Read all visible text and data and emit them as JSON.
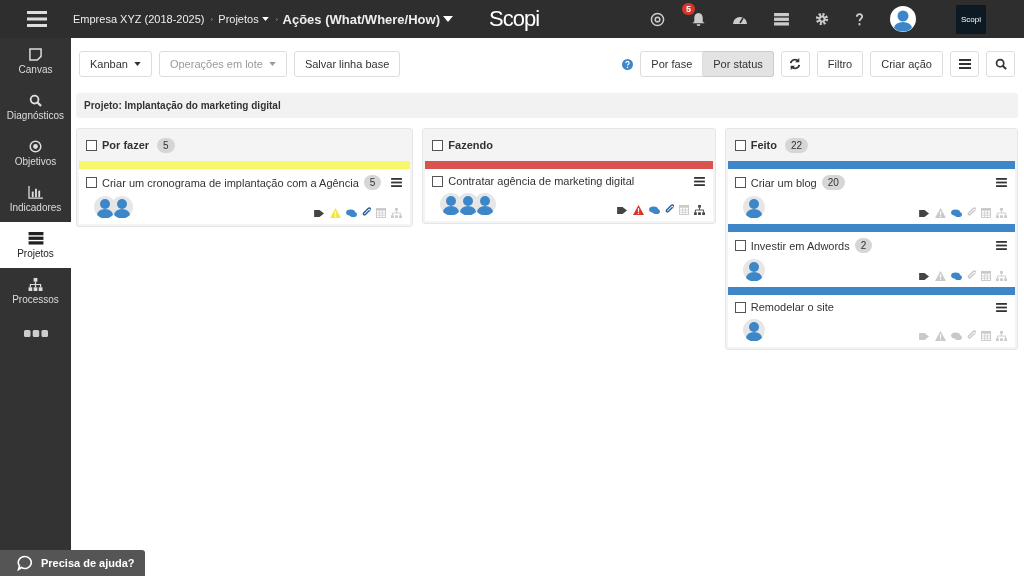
{
  "topbar": {
    "breadcrumb": [
      {
        "label": "Empresa XYZ (2018-2025)",
        "dropdown": false,
        "current": false
      },
      {
        "label": "Projetos",
        "dropdown": true,
        "current": false
      },
      {
        "label": "Ações (What/Where/How)",
        "dropdown": true,
        "current": true
      }
    ],
    "logo": "Scopi",
    "notifications": "5",
    "brand": "Scopi"
  },
  "sidebar": {
    "items": [
      {
        "kind": "canvas",
        "label": "Canvas",
        "selected": false
      },
      {
        "kind": "search",
        "label": "Diagnósticos",
        "selected": false
      },
      {
        "kind": "target",
        "label": "Objetivos",
        "selected": false
      },
      {
        "kind": "chart",
        "label": "Indicadores",
        "selected": false
      },
      {
        "kind": "projects",
        "label": "Projetos",
        "selected": true
      },
      {
        "kind": "org",
        "label": "Processos",
        "selected": false
      }
    ]
  },
  "toolbar": {
    "left": [
      {
        "label": "Kanban",
        "dropdown": true,
        "disabled": false
      },
      {
        "label": "Operações em lote",
        "dropdown": true,
        "disabled": true
      },
      {
        "label": "Salvar linha base",
        "dropdown": false,
        "disabled": false
      }
    ],
    "views": [
      {
        "label": "Por fase",
        "selected": false
      },
      {
        "label": "Por status",
        "selected": true
      }
    ],
    "filter": "Filtro",
    "create": "Criar ação"
  },
  "project": "Projeto: Implantação do marketing digital",
  "columns": [
    {
      "title": "Por fazer",
      "count": "5",
      "checked": false,
      "color": "#f7f76a",
      "kind": "shared",
      "cards": [
        {
          "title": "Criar um cronograma de implantação com a Agência",
          "count": "5",
          "checked": false,
          "assignees": [
            {
              "kind": "avatar"
            },
            {
              "kind": "avatar"
            }
          ],
          "indicators": [
            {
              "kind": "tag",
              "on": true
            },
            {
              "kind": "warning",
              "on": true,
              "color": "#f2e642"
            },
            {
              "kind": "comment",
              "on": true
            },
            {
              "kind": "attach",
              "on": true
            },
            {
              "kind": "calendar",
              "on": false
            },
            {
              "kind": "hierarchy",
              "on": false
            }
          ]
        }
      ]
    },
    {
      "title": "Fazendo",
      "checked": false,
      "color": "#d9534f",
      "kind": "shared",
      "cards": [
        {
          "title": "Contratar agência de marketing digital",
          "checked": false,
          "assignees": [
            {
              "kind": "avatar"
            },
            {
              "kind": "avatar"
            },
            {
              "kind": "avatar"
            }
          ],
          "indicators": [
            {
              "kind": "tag",
              "on": true
            },
            {
              "kind": "warning",
              "on": true,
              "color": "#d9342b"
            },
            {
              "kind": "comment",
              "on": true
            },
            {
              "kind": "attach",
              "on": true
            },
            {
              "kind": "calendar",
              "on": false
            },
            {
              "kind": "hierarchy",
              "on": true
            }
          ]
        }
      ]
    },
    {
      "title": "Feito",
      "count": "22",
      "checked": false,
      "color": "#3d87c9",
      "kind": "per_card",
      "cards": [
        {
          "title": "Criar um blog",
          "count": "20",
          "checked": false,
          "assignees": [
            {
              "kind": "avatar"
            }
          ],
          "indicators": [
            {
              "kind": "tag",
              "on": true
            },
            {
              "kind": "warning",
              "on": false
            },
            {
              "kind": "comment",
              "on": true
            },
            {
              "kind": "attach",
              "on": false
            },
            {
              "kind": "calendar",
              "on": false
            },
            {
              "kind": "hierarchy",
              "on": false
            }
          ]
        },
        {
          "title": "Investir em Adwords",
          "count": "2",
          "checked": false,
          "assignees": [
            {
              "kind": "avatar"
            }
          ],
          "indicators": [
            {
              "kind": "tag",
              "on": true
            },
            {
              "kind": "warning",
              "on": false
            },
            {
              "kind": "comment",
              "on": true
            },
            {
              "kind": "attach",
              "on": false
            },
            {
              "kind": "calendar",
              "on": false
            },
            {
              "kind": "hierarchy",
              "on": false
            }
          ]
        },
        {
          "title": "Remodelar o site",
          "checked": false,
          "assignees": [
            {
              "kind": "avatar"
            }
          ],
          "indicators": [
            {
              "kind": "tag",
              "on": false
            },
            {
              "kind": "warning",
              "on": false
            },
            {
              "kind": "comment",
              "on": false
            },
            {
              "kind": "attach",
              "on": false
            },
            {
              "kind": "calendar",
              "on": false
            },
            {
              "kind": "hierarchy",
              "on": false
            }
          ]
        }
      ]
    }
  ],
  "help": "Precisa de ajuda?"
}
